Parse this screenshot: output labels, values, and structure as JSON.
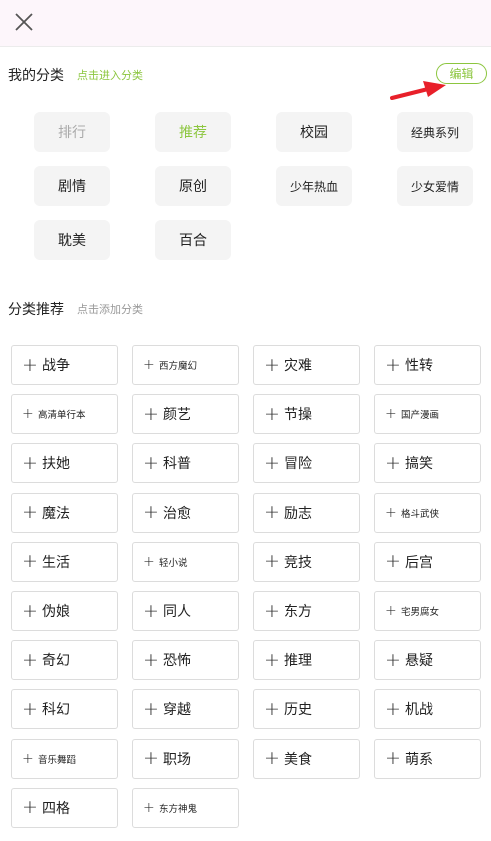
{
  "my_section": {
    "title": "我的分类",
    "hint": "点击进入分类",
    "edit_label": "编辑",
    "items": [
      {
        "label": "排行",
        "state": "disabled",
        "size": "normal"
      },
      {
        "label": "推荐",
        "state": "active",
        "size": "normal"
      },
      {
        "label": "校园",
        "state": "normal",
        "size": "normal"
      },
      {
        "label": "经典系列",
        "state": "normal",
        "size": "small"
      },
      {
        "label": "剧情",
        "state": "normal",
        "size": "normal"
      },
      {
        "label": "原创",
        "state": "normal",
        "size": "normal"
      },
      {
        "label": "少年热血",
        "state": "normal",
        "size": "small"
      },
      {
        "label": "少女爱情",
        "state": "normal",
        "size": "small"
      },
      {
        "label": "耽美",
        "state": "normal",
        "size": "normal"
      },
      {
        "label": "百合",
        "state": "normal",
        "size": "normal"
      }
    ]
  },
  "rec_section": {
    "title": "分类推荐",
    "hint": "点击添加分类",
    "items": [
      {
        "label": "战争",
        "size": "normal"
      },
      {
        "label": "西方魔幻",
        "size": "small"
      },
      {
        "label": "灾难",
        "size": "normal"
      },
      {
        "label": "性转",
        "size": "normal"
      },
      {
        "label": "高清单行本",
        "size": "small"
      },
      {
        "label": "颜艺",
        "size": "normal"
      },
      {
        "label": "节操",
        "size": "normal"
      },
      {
        "label": "国产漫画",
        "size": "small"
      },
      {
        "label": "扶她",
        "size": "normal"
      },
      {
        "label": "科普",
        "size": "normal"
      },
      {
        "label": "冒险",
        "size": "normal"
      },
      {
        "label": "搞笑",
        "size": "normal"
      },
      {
        "label": "魔法",
        "size": "normal"
      },
      {
        "label": "治愈",
        "size": "normal"
      },
      {
        "label": "励志",
        "size": "normal"
      },
      {
        "label": "格斗武侠",
        "size": "small"
      },
      {
        "label": "生活",
        "size": "normal"
      },
      {
        "label": "轻小说",
        "size": "small"
      },
      {
        "label": "竞技",
        "size": "normal"
      },
      {
        "label": "后宫",
        "size": "normal"
      },
      {
        "label": "伪娘",
        "size": "normal"
      },
      {
        "label": "同人",
        "size": "normal"
      },
      {
        "label": "东方",
        "size": "normal"
      },
      {
        "label": "宅男腐女",
        "size": "small"
      },
      {
        "label": "奇幻",
        "size": "normal"
      },
      {
        "label": "恐怖",
        "size": "normal"
      },
      {
        "label": "推理",
        "size": "normal"
      },
      {
        "label": "悬疑",
        "size": "normal"
      },
      {
        "label": "科幻",
        "size": "normal"
      },
      {
        "label": "穿越",
        "size": "normal"
      },
      {
        "label": "历史",
        "size": "normal"
      },
      {
        "label": "机战",
        "size": "normal"
      },
      {
        "label": "音乐舞蹈",
        "size": "small"
      },
      {
        "label": "职场",
        "size": "normal"
      },
      {
        "label": "美食",
        "size": "normal"
      },
      {
        "label": "萌系",
        "size": "normal"
      },
      {
        "label": "四格",
        "size": "normal"
      },
      {
        "label": "东方神鬼",
        "size": "small"
      }
    ]
  },
  "icons": {
    "close": "close-icon",
    "plus": "plus-icon",
    "arrow": "arrow-icon"
  },
  "colors": {
    "accent": "#8cc63f",
    "arrow": "#e8202a",
    "chip_bg": "#f4f4f4",
    "border": "#dcdcdc"
  }
}
